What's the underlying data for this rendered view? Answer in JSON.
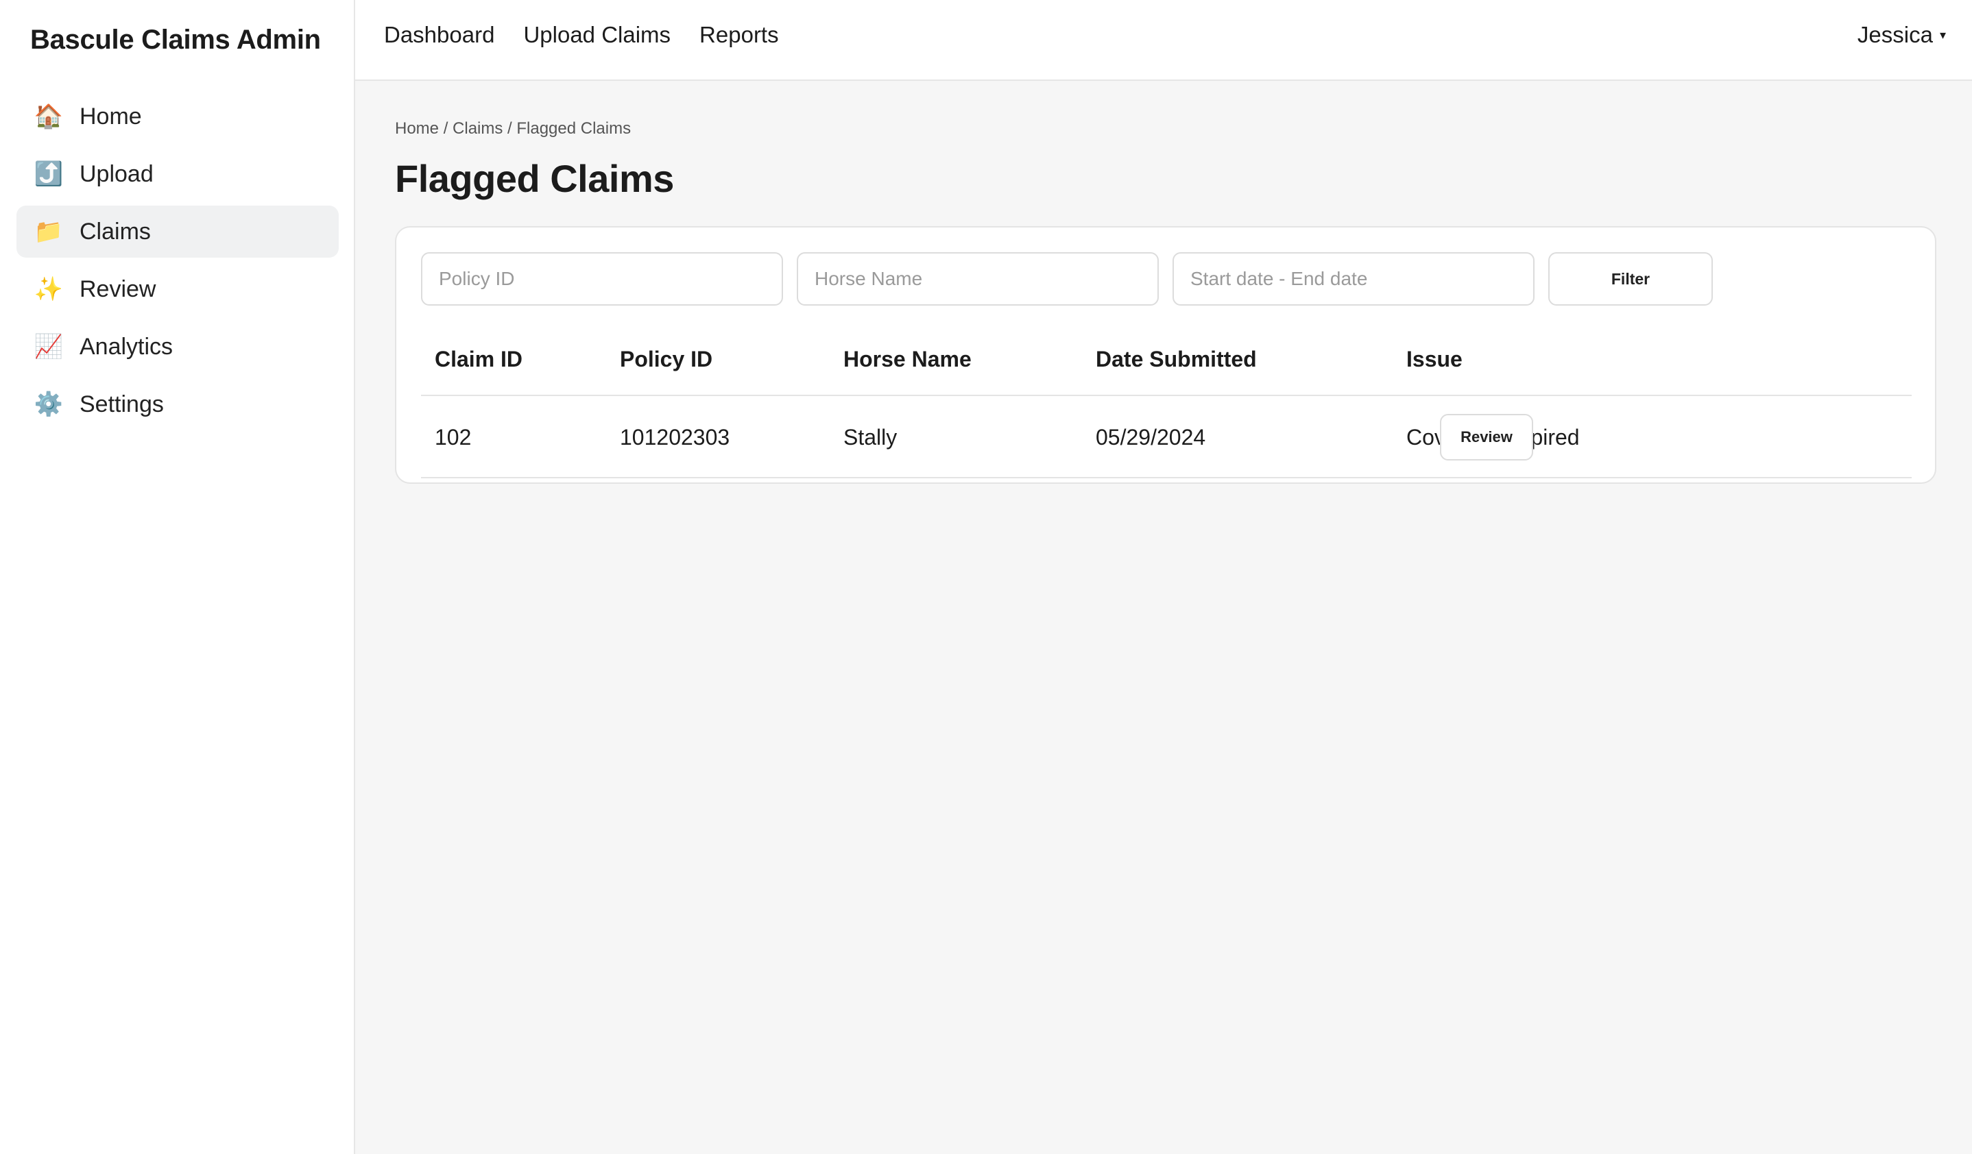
{
  "app": {
    "title": "Bascule Claims Admin"
  },
  "sidebar": {
    "items": [
      {
        "label": "Home",
        "icon": "home-icon",
        "glyph": "🏠"
      },
      {
        "label": "Upload",
        "icon": "upload-icon",
        "glyph": "⤴️"
      },
      {
        "label": "Claims",
        "icon": "folder-icon",
        "glyph": "📁",
        "active": true
      },
      {
        "label": "Review",
        "icon": "sparkles-icon",
        "glyph": "✨"
      },
      {
        "label": "Analytics",
        "icon": "chart-icon",
        "glyph": "📈"
      },
      {
        "label": "Settings",
        "icon": "gear-icon",
        "glyph": "⚙️"
      }
    ]
  },
  "topbar": {
    "links": [
      "Dashboard",
      "Upload Claims",
      "Reports"
    ],
    "user": "Jessica",
    "user_caret": "▾"
  },
  "breadcrumb": "Home / Claims / Flagged Claims",
  "page": {
    "title": "Flagged Claims"
  },
  "filters": {
    "policy_placeholder": "Policy ID",
    "horse_placeholder": "Horse Name",
    "date_placeholder": "Start date - End date",
    "filter_label": "Filter"
  },
  "table": {
    "headers": [
      "Claim ID",
      "Policy ID",
      "Horse Name",
      "Date Submitted",
      "Issue"
    ],
    "rows": [
      {
        "claim_id": "102",
        "policy_id": "101202303",
        "horse_name": "Stally",
        "date_submitted": "05/29/2024",
        "issue": "Coverage expired",
        "action": "Review"
      }
    ]
  }
}
